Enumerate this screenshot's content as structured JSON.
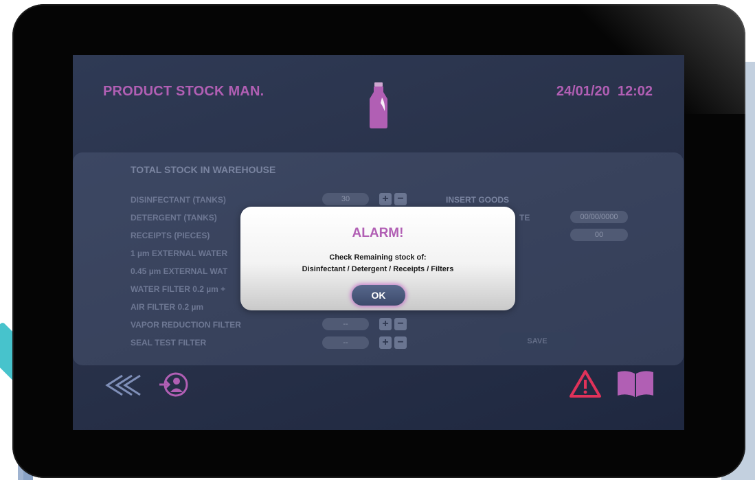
{
  "header": {
    "title": "PRODUCT STOCK MAN.",
    "date": "24/01/20",
    "time": "12:02",
    "product_icon": "bottle-icon"
  },
  "stock": {
    "title": "TOTAL STOCK IN WAREHOUSE",
    "rows": [
      {
        "label": "DISINFECTANT (TANKS)",
        "value": "30"
      },
      {
        "label": "DETERGENT (TANKS)",
        "value": ""
      },
      {
        "label": "RECEIPTS (PIECES)",
        "value": ""
      },
      {
        "label": "1 µm EXTERNAL WATER",
        "value": ""
      },
      {
        "label": "0.45 µm EXTERNAL WAT",
        "value": ""
      },
      {
        "label": "WATER FILTER 0.2 µm +",
        "value": ""
      },
      {
        "label": "AIR FILTER 0.2 µm",
        "value": ""
      },
      {
        "label": "VAPOR REDUCTION FILTER",
        "value": "--"
      },
      {
        "label": "SEAL TEST FILTER",
        "value": "--"
      }
    ],
    "plus": "+",
    "minus": "−"
  },
  "insert": {
    "title": "INSERT GOODS",
    "date_label": "TE",
    "date_value": "00/00/0000",
    "qty_value": "00",
    "save_label": "SAVE"
  },
  "alarm": {
    "title": "ALARM!",
    "line1": "Check Remaining stock of:",
    "line2": "Disinfectant / Detergent / Receipts / Filters",
    "ok_label": "OK"
  },
  "footer": {
    "back_icon": "double-chevron-left-icon",
    "logout_icon": "user-logout-icon",
    "warning_icon": "warning-icon",
    "manual_icon": "book-icon"
  },
  "colors": {
    "accent": "#b15fb4",
    "warning": "#e0325a",
    "back": "#7f8fb8"
  }
}
